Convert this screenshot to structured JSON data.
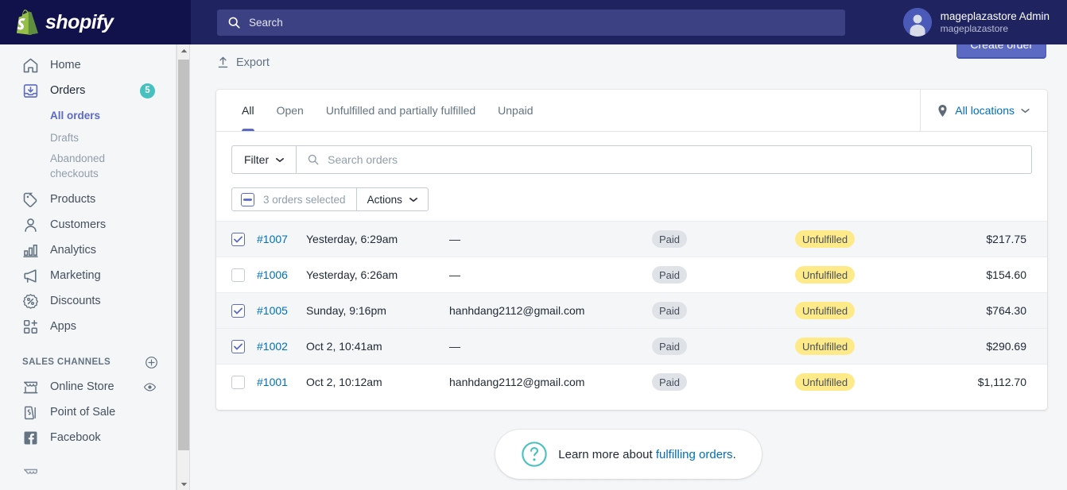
{
  "topbar": {
    "brand_name": "shopify",
    "search": {
      "placeholder": "Search",
      "value": "",
      "icon": "search-icon"
    },
    "user": {
      "name": "mageplazastore Admin",
      "store": "mageplazastore",
      "avatar": "user-avatar-icon"
    }
  },
  "sidebar": {
    "items": [
      {
        "label": "Home",
        "icon": "home-icon"
      },
      {
        "label": "Orders",
        "icon": "orders-inbox-icon",
        "badge": "5"
      },
      {
        "label": "Products",
        "icon": "tag-icon"
      },
      {
        "label": "Customers",
        "icon": "person-icon"
      },
      {
        "label": "Analytics",
        "icon": "bar-chart-icon"
      },
      {
        "label": "Marketing",
        "icon": "megaphone-icon"
      },
      {
        "label": "Discounts",
        "icon": "percent-badge-icon"
      },
      {
        "label": "Apps",
        "icon": "apps-grid-plus-icon"
      }
    ],
    "orders_subnav": [
      {
        "label": "All orders",
        "selected": true
      },
      {
        "label": "Drafts",
        "selected": false
      },
      {
        "label": "Abandoned checkouts",
        "selected": false
      }
    ],
    "sales_channels": {
      "title": "SALES CHANNELS",
      "add_icon": "plus-circle-icon",
      "items": [
        {
          "label": "Online Store",
          "icon": "storefront-icon",
          "trailing_icon": "eye-icon"
        },
        {
          "label": "Point of Sale",
          "icon": "pos-tag-icon"
        },
        {
          "label": "Facebook",
          "icon": "facebook-icon"
        }
      ]
    }
  },
  "toolbar": {
    "export_label": "Export",
    "export_icon": "upload-icon",
    "create_order_label": "Create order"
  },
  "card": {
    "tabs": [
      {
        "label": "All",
        "active": true
      },
      {
        "label": "Open",
        "active": false
      },
      {
        "label": "Unfulfilled and partially fulfilled",
        "active": false
      },
      {
        "label": "Unpaid",
        "active": false
      }
    ],
    "locations": {
      "label": "All locations",
      "icon": "location-pin-icon",
      "chevron": "chevron-down-icon"
    },
    "filter": {
      "button_label": "Filter",
      "chevron": "chevron-down-icon",
      "search_placeholder": "Search orders",
      "search_value": "",
      "search_icon": "search-icon"
    },
    "bulk": {
      "selected_label": "3 orders selected",
      "checkbox_state": "indeterminate",
      "actions_label": "Actions",
      "chevron": "chevron-down-icon"
    },
    "rows": [
      {
        "checked": true,
        "order": "#1007",
        "date": "Yesterday, 6:29am",
        "customer": "—",
        "payment": "Paid",
        "fulfillment": "Unfulfilled",
        "total": "$217.75"
      },
      {
        "checked": false,
        "order": "#1006",
        "date": "Yesterday, 6:26am",
        "customer": "—",
        "payment": "Paid",
        "fulfillment": "Unfulfilled",
        "total": "$154.60"
      },
      {
        "checked": true,
        "order": "#1005",
        "date": "Sunday, 9:16pm",
        "customer": "hanhdang2112@gmail.com",
        "payment": "Paid",
        "fulfillment": "Unfulfilled",
        "total": "$764.30"
      },
      {
        "checked": true,
        "order": "#1002",
        "date": "Oct 2, 10:41am",
        "customer": "—",
        "payment": "Paid",
        "fulfillment": "Unfulfilled",
        "total": "$290.69"
      },
      {
        "checked": false,
        "order": "#1001",
        "date": "Oct 2, 10:12am",
        "customer": "hanhdang2112@gmail.com",
        "payment": "Paid",
        "fulfillment": "Unfulfilled",
        "total": "$1,112.70"
      }
    ]
  },
  "help": {
    "icon": "question-circle-icon",
    "text_prefix": "Learn more about ",
    "link_label": "fulfilling orders",
    "text_suffix": "."
  },
  "colors": {
    "topbar": "#1f2460",
    "brand_block": "#11114b",
    "accent_purple": "#5c6ac4",
    "link_blue": "#006fbb",
    "badge_teal": "#47c1bf",
    "pill_paid": "#dfe3e8",
    "pill_unfulfilled": "#ffea8a",
    "page_bg": "#f4f6f8"
  }
}
